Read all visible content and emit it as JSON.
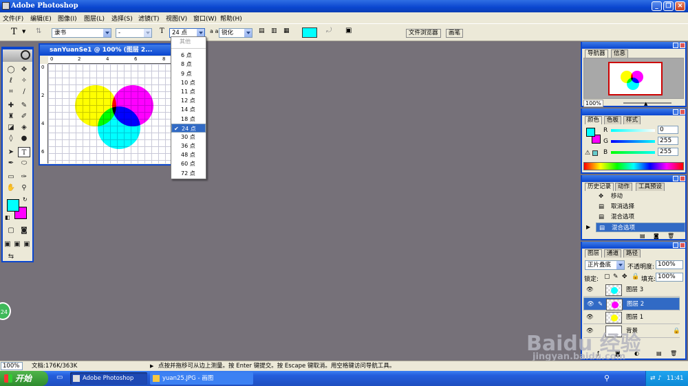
{
  "app": {
    "title": "Adobe Photoshop"
  },
  "menu": [
    "文件(F)",
    "编辑(E)",
    "图像(I)",
    "图层(L)",
    "选择(S)",
    "滤镜(T)",
    "视图(V)",
    "窗口(W)",
    "帮助(H)"
  ],
  "options": {
    "tool_glyph": "T",
    "font_family": "隶书",
    "font_style": "-",
    "font_size": "24 点",
    "aa_label": "a a",
    "antialias": "锐化",
    "color_swatch": "#00ffff",
    "file_browser_tab": "文件浏览器",
    "brushes_tab": "画笔"
  },
  "document": {
    "title": "sanYuanSe1 @ 100% (图层 2...",
    "ruler_h": [
      "0",
      "2",
      "4",
      "6",
      "8"
    ],
    "ruler_v": [
      "0",
      "2",
      "4",
      "6"
    ],
    "circles": [
      "#ffff00",
      "#ff00ff",
      "#00ffff"
    ]
  },
  "size_menu": {
    "header": "其他",
    "items": [
      "6 点",
      "8 点",
      "9 点",
      "10 点",
      "11 点",
      "12 点",
      "14 点",
      "18 点",
      "24 点",
      "30 点",
      "36 点",
      "48 点",
      "60 点",
      "72 点"
    ],
    "selected": "24 点",
    "check": "✔"
  },
  "toolbox": {
    "fg_color": "#00ffff",
    "bg_color": "#ff00ff"
  },
  "navigator": {
    "tabs": [
      "导航器",
      "信息"
    ],
    "zoom": "100%"
  },
  "color_panel": {
    "tabs": [
      "颜色",
      "色板",
      "样式"
    ],
    "channels": [
      {
        "label": "R",
        "value": "0"
      },
      {
        "label": "G",
        "value": "255"
      },
      {
        "label": "B",
        "value": "255"
      }
    ]
  },
  "history_panel": {
    "tabs": [
      "历史记录",
      "动作",
      "工具预设"
    ],
    "items": [
      "移动",
      "取消选择",
      "混合选项",
      "混合选项"
    ],
    "selected_index": 3
  },
  "layers_panel": {
    "tabs": [
      "图层",
      "通道",
      "路径"
    ],
    "blend_mode": "正片叠底",
    "opacity_label": "不透明度:",
    "opacity": "100%",
    "lock_label": "锁定:",
    "fill_label": "填充:",
    "fill": "100%",
    "layers": [
      {
        "name": "图层 3"
      },
      {
        "name": "图层 2"
      },
      {
        "name": "图层 1"
      },
      {
        "name": "背景"
      }
    ],
    "selected_index": 1
  },
  "statusbar": {
    "zoom": "100%",
    "doc": "文档:176K/363K",
    "hint": "点按并拖移可从边上测量。按 Enter 键提交。按 Escape 键取消。用空格键访问导航工具。"
  },
  "taskbar": {
    "start": "开始",
    "tasks": [
      "Adobe Photoshop",
      "yuan25.JPG - 画图"
    ],
    "clock": "11:41"
  },
  "badge": "24",
  "watermark": {
    "logo": "Baidu 经验",
    "url": "jingyan.baidu.com"
  }
}
